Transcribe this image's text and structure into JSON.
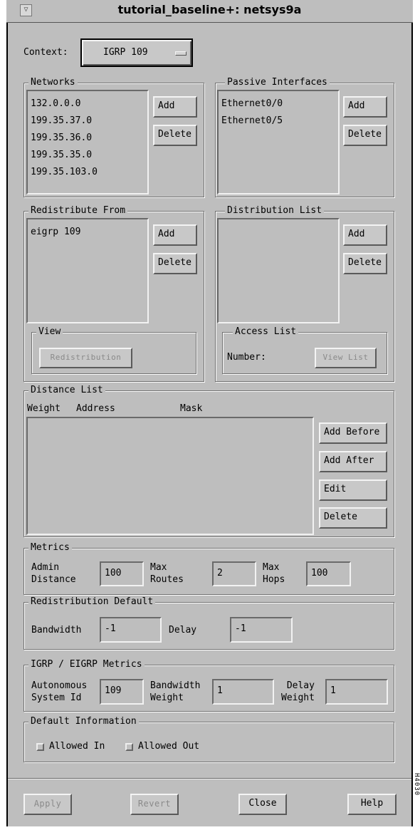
{
  "window": {
    "title": "tutorial_baseline+: netsys9a",
    "menu_glyph": "▽"
  },
  "context": {
    "label": "Context:",
    "value": "IGRP 109"
  },
  "networks": {
    "legend": "Networks",
    "items": [
      "132.0.0.0",
      "199.35.37.0",
      "199.35.36.0",
      "199.35.35.0",
      "199.35.103.0"
    ],
    "add": "Add",
    "delete": "Delete"
  },
  "passive": {
    "legend": "Passive Interfaces",
    "items": [
      "Ethernet0/0",
      "Ethernet0/5"
    ],
    "add": "Add",
    "delete": "Delete"
  },
  "redistribute": {
    "legend": "Redistribute From",
    "items": [
      "eigrp 109"
    ],
    "add": "Add",
    "delete": "Delete",
    "view_legend": "View",
    "view_button": "Redistribution"
  },
  "distribution": {
    "legend": "Distribution List",
    "add": "Add",
    "delete": "Delete",
    "access_legend": "Access List",
    "number_label": "Number:",
    "view_list": "View List"
  },
  "distance": {
    "legend": "Distance List",
    "col_weight": "Weight",
    "col_address": "Address",
    "col_mask": "Mask",
    "add_before": "Add Before",
    "add_after": "Add After",
    "edit": "Edit",
    "delete": "Delete"
  },
  "metrics": {
    "legend": "Metrics",
    "admin_label_1": "Admin",
    "admin_label_2": "Distance",
    "admin_value": "100",
    "routes_label_1": "Max",
    "routes_label_2": "Routes",
    "routes_value": "2",
    "hops_label_1": "Max",
    "hops_label_2": "Hops",
    "hops_value": "100"
  },
  "redist_default": {
    "legend": "Redistribution Default",
    "bandwidth_label": "Bandwidth",
    "bandwidth_value": "-1",
    "delay_label": "Delay",
    "delay_value": "-1"
  },
  "igrp": {
    "legend": "IGRP / EIGRP Metrics",
    "as_label_1": "Autonomous",
    "as_label_2": "System Id",
    "as_value": "109",
    "bw_label_1": "Bandwidth",
    "bw_label_2": "Weight",
    "bw_value": "1",
    "delay_label_1": "Delay",
    "delay_label_2": "Weight",
    "delay_value": "1"
  },
  "default_info": {
    "legend": "Default Information",
    "allowed_in": "Allowed In",
    "allowed_out": "Allowed Out"
  },
  "footer": {
    "apply": "Apply",
    "revert": "Revert",
    "close": "Close",
    "help": "Help"
  },
  "side_note": "H4030"
}
